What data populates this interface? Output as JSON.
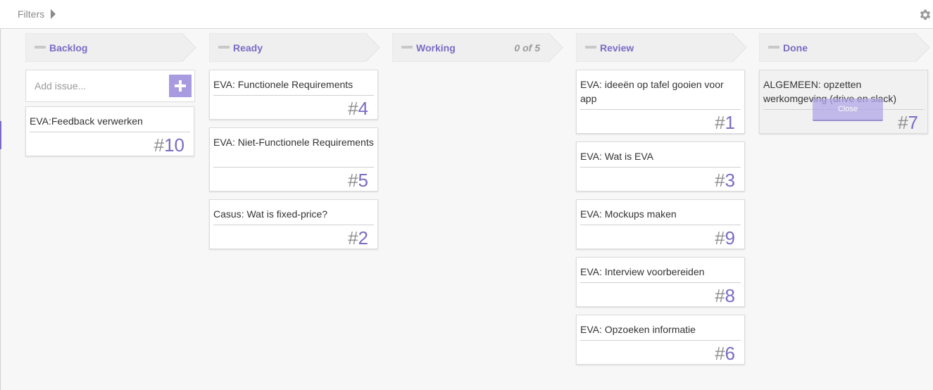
{
  "topbar": {
    "filters_label": "Filters",
    "settings_icon": "gear-icon"
  },
  "accent_color": "#7c6bc4",
  "columns": [
    {
      "title": "Backlog",
      "wip": "",
      "add_placeholder": "Add issue...",
      "cards": [
        {
          "title": "EVA:Feedback verwerken",
          "number": "10"
        }
      ]
    },
    {
      "title": "Ready",
      "wip": "",
      "cards": [
        {
          "title": "EVA: Functionele Requirements",
          "number": "4"
        },
        {
          "title": "EVA: Niet-Functionele Requirements",
          "number": "5"
        },
        {
          "title": "Casus: Wat is fixed-price?",
          "number": "2"
        }
      ]
    },
    {
      "title": "Working",
      "wip": "0 of 5",
      "cards": []
    },
    {
      "title": "Review",
      "wip": "",
      "cards": [
        {
          "title": "EVA: ideeën op tafel gooien voor app",
          "number": "1"
        },
        {
          "title": "EVA: Wat is EVA",
          "number": "3"
        },
        {
          "title": "EVA: Mockups maken",
          "number": "9"
        },
        {
          "title": "EVA: Interview voorbereiden",
          "number": "8"
        },
        {
          "title": "EVA: Opzoeken informatie",
          "number": "6"
        }
      ]
    },
    {
      "title": "Done",
      "wip": "",
      "cards": [
        {
          "title": "ALGEMEEN: opzetten werkomgeving (drive en slack)",
          "number": "7",
          "close_label": "Close"
        }
      ]
    }
  ]
}
